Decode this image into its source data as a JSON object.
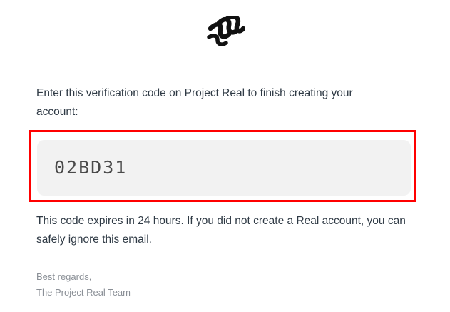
{
  "logo": {
    "icon": "project-real-logo-icon",
    "color": "#111111"
  },
  "email": {
    "intro_text": "Enter this verification code on Project Real to finish creating your account:",
    "verification_code": "02BD31",
    "expiry_text": "This code expires in 24 hours. If you did not create a Real account, you can safely ignore this email.",
    "signoff_line1": "Best regards,",
    "signoff_line2": "The Project Real Team"
  },
  "colors": {
    "highlight_border": "#ff0000",
    "code_background": "#f2f2f2",
    "body_text": "#2f3a45",
    "muted_text": "#8a8f96"
  }
}
